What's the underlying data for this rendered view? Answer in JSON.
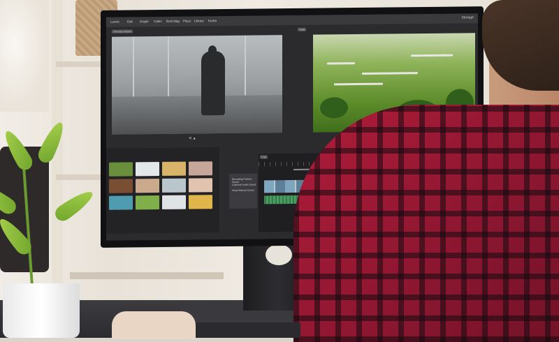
{
  "editor": {
    "menu": [
      "Lorem",
      "Edit",
      "Graph",
      "Cabin",
      "Bod bilag",
      "Placo",
      "Library",
      "Kurba"
    ],
    "top_right": "Storage",
    "left_preview_tag": "Timeline Blonk",
    "right_preview_tag": "Stills",
    "timeline_tag": "Clip",
    "label_panel": [
      "Recording Position Sound",
      "Cutthroat Audio Sound",
      "Aleph Manual Sound"
    ],
    "left_controls": "⟲ ▲",
    "right_controls": "◀ ◉ ▶ ▢"
  },
  "colors": {
    "shirt": "#9b1a34",
    "screen_bg": "#2b2b2e",
    "video_green": "#5d8c2a"
  }
}
